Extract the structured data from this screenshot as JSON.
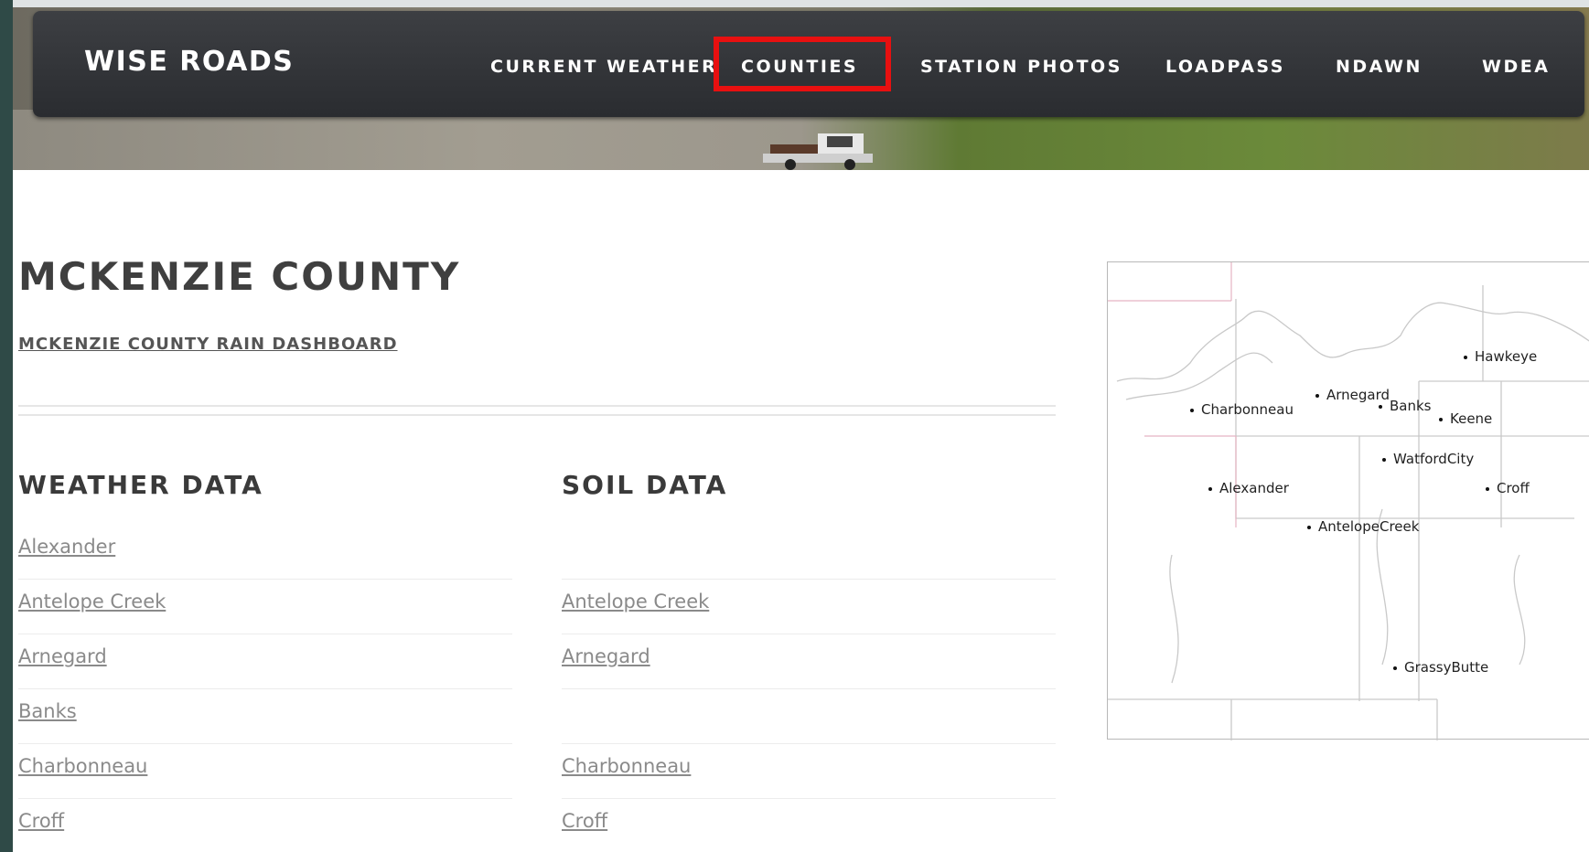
{
  "header": {
    "brand": "WISE ROADS",
    "nav": [
      {
        "label": "CURRENT WEATHER",
        "highlighted": false
      },
      {
        "label": "COUNTIES",
        "highlighted": true
      },
      {
        "label": "STATION PHOTOS",
        "highlighted": false
      },
      {
        "label": "LOADPASS",
        "highlighted": false
      },
      {
        "label": "NDAWN",
        "highlighted": false
      },
      {
        "label": "WDEA",
        "highlighted": false
      }
    ],
    "highlight_color": "#e81010"
  },
  "page": {
    "title": "MCKENZIE COUNTY",
    "dashboard_link": "MCKENZIE COUNTY RAIN DASHBOARD"
  },
  "weather_data": {
    "heading": "WEATHER DATA",
    "links": [
      "Alexander",
      "Antelope Creek",
      "Arnegard",
      "Banks",
      "Charbonneau",
      "Croff"
    ]
  },
  "soil_data": {
    "heading": "SOIL DATA",
    "links": [
      "",
      "Antelope Creek",
      "Arnegard",
      "",
      "Charbonneau",
      "Croff"
    ]
  },
  "map": {
    "towns": [
      "Hawkeye",
      "Arnegard",
      "Charbonneau",
      "Banks",
      "Keene",
      "WatfordCity",
      "Alexander",
      "Croff",
      "AntelopeCreek",
      "GrassyButte"
    ]
  }
}
